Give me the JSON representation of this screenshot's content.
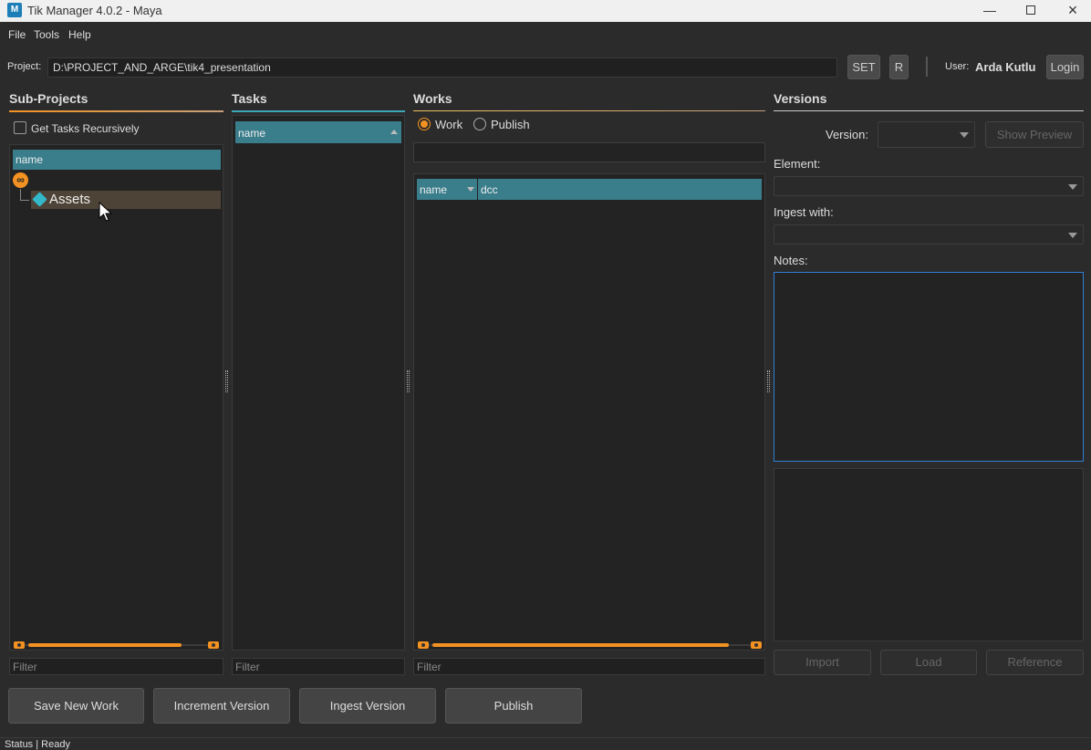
{
  "window": {
    "title": "Tik Manager 4.0.2 - Maya",
    "app_icon_letter": "M"
  },
  "menu": [
    "File",
    "Tools",
    "Help"
  ],
  "project": {
    "label": "Project:",
    "path": "D:\\PROJECT_AND_ARGE\\tik4_presentation",
    "set_label": "SET",
    "r_label": "R"
  },
  "user": {
    "label": "User:",
    "name": "Arda Kutlu",
    "login_label": "Login"
  },
  "subprojects": {
    "title": "Sub-Projects",
    "recursive_label": "Get Tasks Recursively",
    "column": "name",
    "items": [
      {
        "label": "Assets"
      }
    ],
    "filter_placeholder": "Filter"
  },
  "tasks": {
    "title": "Tasks",
    "column": "name",
    "filter_placeholder": "Filter"
  },
  "works": {
    "title": "Works",
    "mode_work": "Work",
    "mode_publish": "Publish",
    "columns": [
      "name",
      "dcc"
    ],
    "filter_placeholder": "Filter"
  },
  "versions": {
    "title": "Versions",
    "version_label": "Version:",
    "show_preview_label": "Show Preview",
    "element_label": "Element:",
    "ingest_with_label": "Ingest with:",
    "notes_label": "Notes:",
    "import_label": "Import",
    "load_label": "Load",
    "reference_label": "Reference"
  },
  "actions": {
    "save_new_work": "Save New Work",
    "increment_version": "Increment Version",
    "ingest_version": "Ingest Version",
    "publish": "Publish"
  },
  "status": {
    "text": "Status | Ready"
  },
  "colors": {
    "accent": "#f39222",
    "header_teal": "#3a7e8c",
    "selection_brown": "#4e4337"
  }
}
